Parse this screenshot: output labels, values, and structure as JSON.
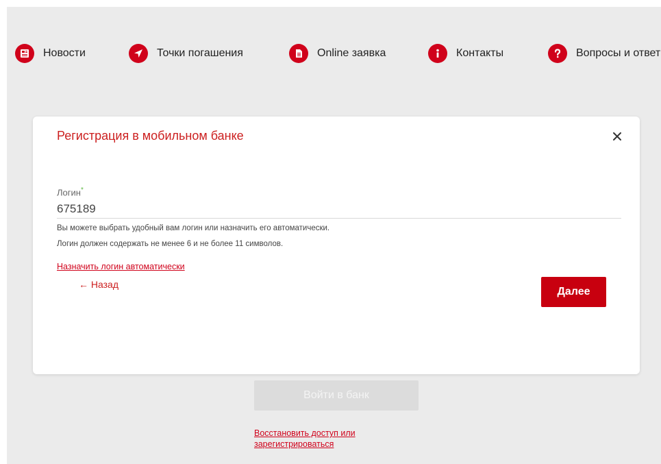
{
  "nav": {
    "items": [
      {
        "label": "Новости",
        "icon": "newspaper-icon"
      },
      {
        "label": "Точки погашения",
        "icon": "location-arrow-icon"
      },
      {
        "label": "Online заявка",
        "icon": "document-icon"
      },
      {
        "label": "Контакты",
        "icon": "info-icon"
      },
      {
        "label": "Вопросы и ответы",
        "icon": "question-icon"
      }
    ]
  },
  "modal": {
    "title": "Регистрация в мобильном банке",
    "close_symbol": "×",
    "login_label": "Логин",
    "required_mark": "*",
    "login_value": "675189",
    "hint_line1": "Вы можете выбрать удобный вам логин или назначить его автоматически.",
    "hint_line2": "Логин должен содержать не менее 6 и не более 11 символов.",
    "auto_login_link": "Назначить логин автоматически",
    "back_link": "← Назад",
    "next_button": "Далее"
  },
  "page": {
    "enter_bank_button": "Войти в банк",
    "restore_link": "Восстановить доступ или зарегистрироваться"
  },
  "colors": {
    "accent": "#d0021b",
    "title": "#cc1f1f",
    "required": "#5db843",
    "background": "#ebebeb"
  }
}
